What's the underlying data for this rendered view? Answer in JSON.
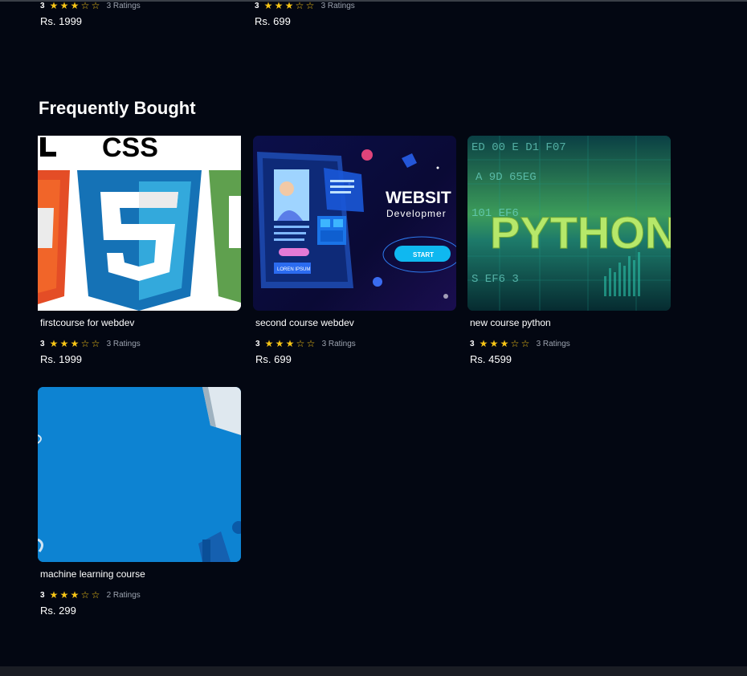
{
  "top_cards": [
    {
      "rating": "3",
      "stars_full": 3,
      "ratings_label": "3 Ratings",
      "price": "Rs. 1999"
    },
    {
      "rating": "3",
      "stars_full": 3,
      "ratings_label": "3 Ratings",
      "price": "Rs. 699"
    }
  ],
  "section": {
    "title": "Frequently Bought"
  },
  "courses": [
    {
      "title": "firstcourse for webdev",
      "rating": "3",
      "stars_full": 3,
      "ratings_label": "3 Ratings",
      "price": "Rs. 1999",
      "image_text": "CSS"
    },
    {
      "title": "second course webdev",
      "rating": "3",
      "stars_full": 3,
      "ratings_label": "3 Ratings",
      "price": "Rs. 699",
      "image_text": "WEBSIT",
      "image_sub": "Developmer",
      "image_btn": "START",
      "image_small": "LOREN IPSUM"
    },
    {
      "title": "new course python",
      "rating": "3",
      "stars_full": 3,
      "ratings_label": "3 Ratings",
      "price": "Rs. 4599",
      "image_text": "PYTHON"
    },
    {
      "title": "machine learning course",
      "rating": "3",
      "stars_full": 3,
      "ratings_label": "2 Ratings",
      "price": "Rs. 299"
    }
  ],
  "colors": {
    "background": "#030712",
    "star": "#f6c416",
    "muted": "#9ca3af"
  },
  "icons": {
    "star_full": "star-filled-icon",
    "star_empty": "star-outline-icon"
  }
}
